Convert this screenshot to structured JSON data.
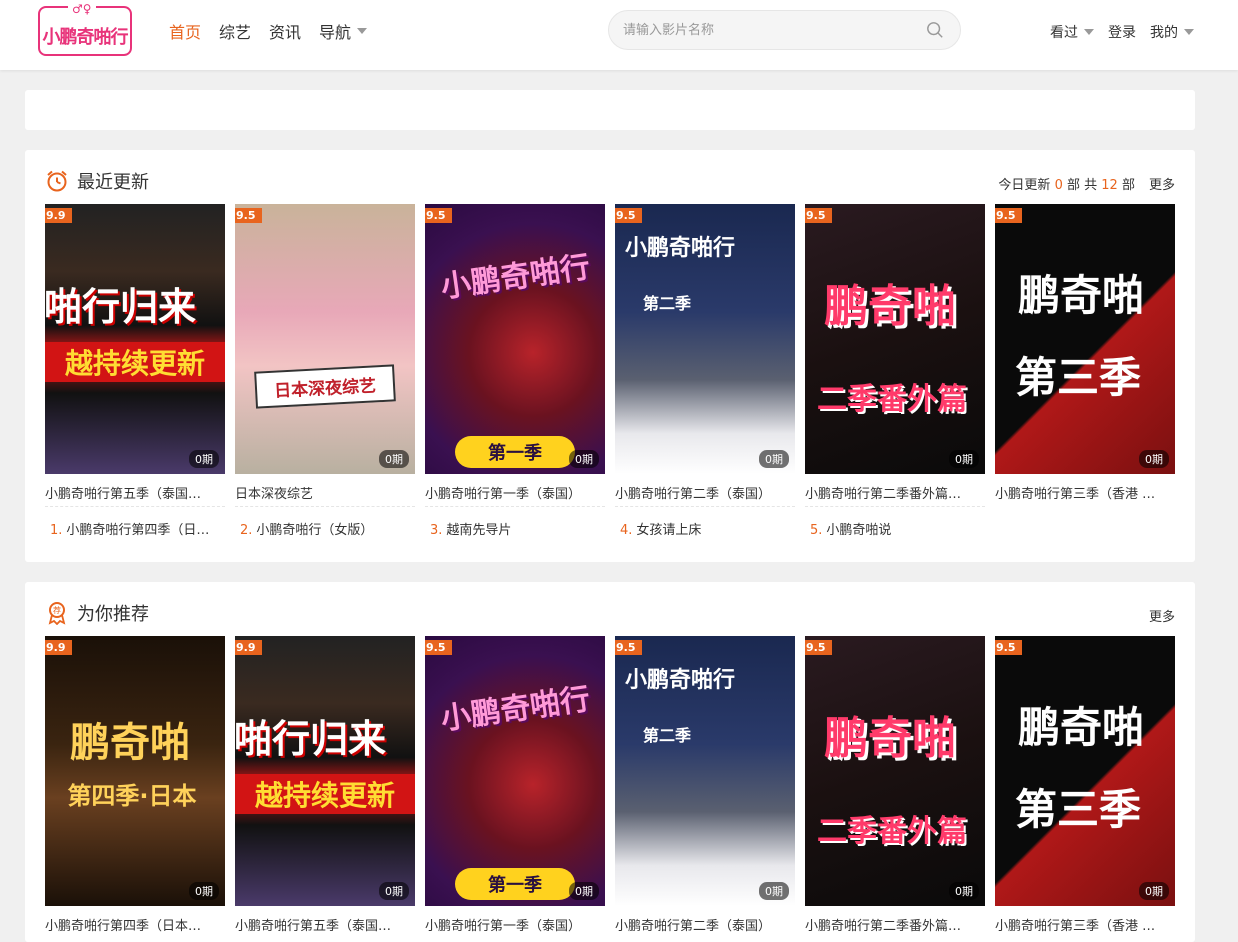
{
  "logo": {
    "text": "小鹏奇啪行",
    "deco": "♂♀"
  },
  "nav": [
    {
      "label": "首页",
      "active": true
    },
    {
      "label": "综艺"
    },
    {
      "label": "资讯"
    },
    {
      "label": "导航"
    }
  ],
  "search": {
    "placeholder": "请输入影片名称"
  },
  "user_nav": [
    "看过",
    "登录",
    "我的"
  ],
  "recent": {
    "title": "最近更新",
    "today_prefix": "今日更新",
    "today_count": "0",
    "mid": "部 共",
    "total": "12",
    "suffix": "部",
    "more": "更多",
    "cards": [
      {
        "score": "9.9",
        "eps": "0期",
        "title": "小鹏奇啪行第五季（泰国…",
        "poster": "啪行归来",
        "poster2": "越持续更新"
      },
      {
        "score": "9.5",
        "eps": "0期",
        "title": "日本深夜综艺",
        "poster": "日本深夜综艺",
        "poster2": ""
      },
      {
        "score": "9.5",
        "eps": "0期",
        "title": "小鹏奇啪行第一季（泰国）",
        "poster": "小鹏奇啪行",
        "poster2": "第一季"
      },
      {
        "score": "9.5",
        "eps": "0期",
        "title": "小鹏奇啪行第二季（泰国）",
        "poster": "小鹏奇啪行",
        "poster2": "第二季"
      },
      {
        "score": "9.5",
        "eps": "0期",
        "title": "小鹏奇啪行第二季番外篇…",
        "poster": "鹏奇啪",
        "poster2": "二季番外篇"
      },
      {
        "score": "9.5",
        "eps": "0期",
        "title": "小鹏奇啪行第三季（香港 …",
        "poster": "鹏奇啪",
        "poster2": "第三季"
      }
    ],
    "hot": [
      {
        "num": "1.",
        "label": "小鹏奇啪行第四季（日…"
      },
      {
        "num": "2.",
        "label": "小鹏奇啪行（女版）"
      },
      {
        "num": "3.",
        "label": "越南先导片"
      },
      {
        "num": "4.",
        "label": "女孩请上床"
      },
      {
        "num": "5.",
        "label": "小鹏奇啪说"
      }
    ]
  },
  "recommend": {
    "title": "为你推荐",
    "more": "更多",
    "cards": [
      {
        "score": "9.9",
        "eps": "0期",
        "title": "小鹏奇啪行第四季（日本…",
        "poster": "鹏奇啪",
        "poster2": "第四季·日本"
      },
      {
        "score": "9.9",
        "eps": "0期",
        "title": "小鹏奇啪行第五季（泰国…",
        "poster": "啪行归来",
        "poster2": "越持续更新"
      },
      {
        "score": "9.5",
        "eps": "0期",
        "title": "小鹏奇啪行第一季（泰国）",
        "poster": "小鹏奇啪行",
        "poster2": "第一季"
      },
      {
        "score": "9.5",
        "eps": "0期",
        "title": "小鹏奇啪行第二季（泰国）",
        "poster": "小鹏奇啪行",
        "poster2": "第二季"
      },
      {
        "score": "9.5",
        "eps": "0期",
        "title": "小鹏奇啪行第二季番外篇…",
        "poster": "鹏奇啪",
        "poster2": "二季番外篇"
      },
      {
        "score": "9.5",
        "eps": "0期",
        "title": "小鹏奇啪行第三季（香港 …",
        "poster": "鹏奇啪",
        "poster2": "第三季"
      }
    ]
  },
  "colors": {
    "accent": "#e8641e",
    "brand": "#e8337a"
  }
}
